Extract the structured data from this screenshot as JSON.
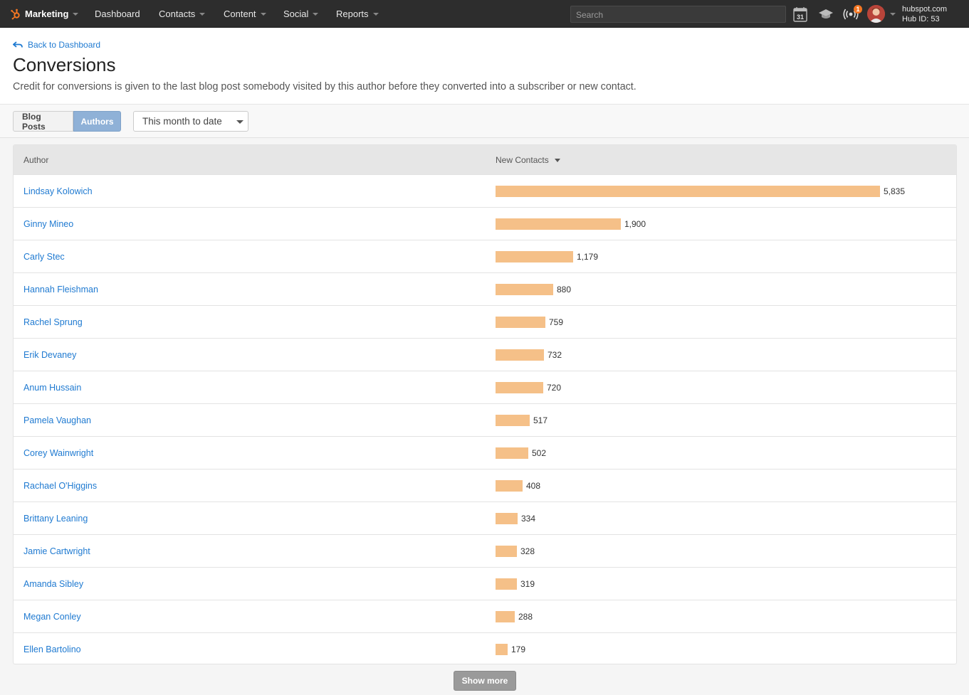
{
  "nav": {
    "brand": "Marketing",
    "items": [
      {
        "label": "Dashboard",
        "dropdown": false
      },
      {
        "label": "Contacts",
        "dropdown": true
      },
      {
        "label": "Content",
        "dropdown": true
      },
      {
        "label": "Social",
        "dropdown": true
      },
      {
        "label": "Reports",
        "dropdown": true
      }
    ],
    "search_placeholder": "Search",
    "calendar_day": "31",
    "notification_count": "1",
    "account_domain": "hubspot.com",
    "hub_id": "Hub ID: 53",
    "accent_color": "#f57722",
    "icons": [
      "sprocket-icon",
      "calendar-icon",
      "academy-cap-icon",
      "notifications-icon",
      "avatar"
    ]
  },
  "header": {
    "back_label": "Back to Dashboard",
    "title": "Conversions",
    "description": "Credit for conversions is given to the last blog post somebody visited by this author before they converted into a subscriber or new contact."
  },
  "toolbar": {
    "tabs": [
      {
        "label": "Blog Posts",
        "active": false
      },
      {
        "label": "Authors",
        "active": true
      }
    ],
    "date_range": "This month to date"
  },
  "table": {
    "columns": [
      "Author",
      "New Contacts"
    ],
    "bar_color": "#f5c088",
    "link_color": "#1f7ad1",
    "rows": [
      {
        "author": "Lindsay Kolowich",
        "value": 5835,
        "value_label": "5,835"
      },
      {
        "author": "Ginny Mineo",
        "value": 1900,
        "value_label": "1,900"
      },
      {
        "author": "Carly Stec",
        "value": 1179,
        "value_label": "1,179"
      },
      {
        "author": "Hannah Fleishman",
        "value": 880,
        "value_label": "880"
      },
      {
        "author": "Rachel Sprung",
        "value": 759,
        "value_label": "759"
      },
      {
        "author": "Erik Devaney",
        "value": 732,
        "value_label": "732"
      },
      {
        "author": "Anum Hussain",
        "value": 720,
        "value_label": "720"
      },
      {
        "author": "Pamela Vaughan",
        "value": 517,
        "value_label": "517"
      },
      {
        "author": "Corey Wainwright",
        "value": 502,
        "value_label": "502"
      },
      {
        "author": "Rachael O'Higgins",
        "value": 408,
        "value_label": "408"
      },
      {
        "author": "Brittany Leaning",
        "value": 334,
        "value_label": "334"
      },
      {
        "author": "Jamie Cartwright",
        "value": 328,
        "value_label": "328"
      },
      {
        "author": "Amanda Sibley",
        "value": 319,
        "value_label": "319"
      },
      {
        "author": "Megan Conley",
        "value": 288,
        "value_label": "288"
      },
      {
        "author": "Ellen Bartolino",
        "value": 179,
        "value_label": "179"
      }
    ],
    "show_more_label": "Show more"
  }
}
